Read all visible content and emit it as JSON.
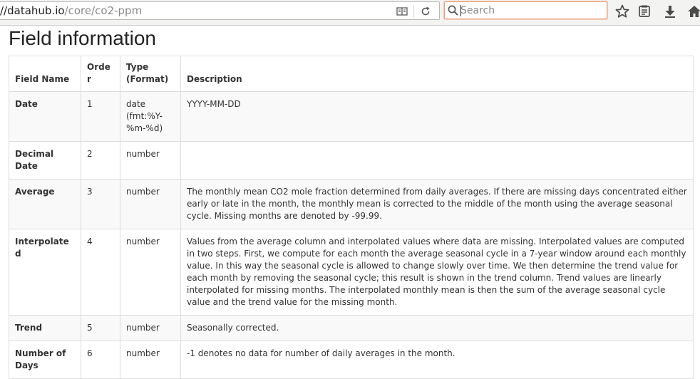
{
  "browser": {
    "url_host": "//datahub.io",
    "url_path": "/core/co2-ppm",
    "search_placeholder": "Search"
  },
  "page": {
    "title": "Field information"
  },
  "table": {
    "headers": {
      "field_name": "Field Name",
      "order": "Order",
      "type_format": "Type (Format)",
      "description": "Description"
    },
    "rows": [
      {
        "name": "Date",
        "order": "1",
        "type": "date (fmt:%Y-%m-%d)",
        "description": "YYYY-MM-DD"
      },
      {
        "name": "Decimal Date",
        "order": "2",
        "type": "number",
        "description": ""
      },
      {
        "name": "Average",
        "order": "3",
        "type": "number",
        "description": "The monthly mean CO2 mole fraction determined from daily averages. If there are missing days concentrated either early or late in the month, the monthly mean is corrected to the middle of the month using the average seasonal cycle. Missing months are denoted by -99.99."
      },
      {
        "name": "Interpolated",
        "order": "4",
        "type": "number",
        "description": "Values from the average column and interpolated values where data are missing. Interpolated values are computed in two steps. First, we compute for each month the average seasonal cycle in a 7-year window around each monthly value. In this way the seasonal cycle is allowed to change slowly over time. We then determine the trend value for each month by removing the seasonal cycle; this result is shown in the trend column. Trend values are linearly interpolated for missing months. The interpolated monthly mean is then the sum of the average seasonal cycle value and the trend value for the missing month."
      },
      {
        "name": "Trend",
        "order": "5",
        "type": "number",
        "description": "Seasonally corrected."
      },
      {
        "name": "Number of Days",
        "order": "6",
        "type": "number",
        "description": "-1 denotes no data for number of daily averages in the month."
      }
    ]
  },
  "colors": {
    "toolbar_bg": "#f3f3f2",
    "search_focus_border": "#e8a07a",
    "table_border": "#dddddd",
    "stripe": "#f9f9f9"
  }
}
